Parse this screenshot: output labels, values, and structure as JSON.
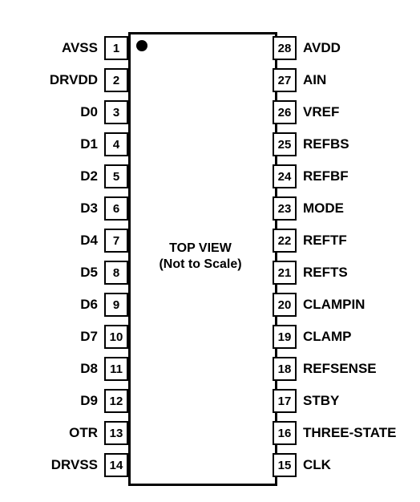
{
  "center": {
    "line1": "TOP VIEW",
    "line2": "(Not to Scale)"
  },
  "leftPins": [
    {
      "num": "1",
      "label": "AVSS"
    },
    {
      "num": "2",
      "label": "DRVDD"
    },
    {
      "num": "3",
      "label": "D0"
    },
    {
      "num": "4",
      "label": "D1"
    },
    {
      "num": "5",
      "label": "D2"
    },
    {
      "num": "6",
      "label": "D3"
    },
    {
      "num": "7",
      "label": "D4"
    },
    {
      "num": "8",
      "label": "D5"
    },
    {
      "num": "9",
      "label": "D6"
    },
    {
      "num": "10",
      "label": "D7"
    },
    {
      "num": "11",
      "label": "D8"
    },
    {
      "num": "12",
      "label": "D9"
    },
    {
      "num": "13",
      "label": "OTR"
    },
    {
      "num": "14",
      "label": "DRVSS"
    }
  ],
  "rightPins": [
    {
      "num": "28",
      "label": "AVDD"
    },
    {
      "num": "27",
      "label": "AIN"
    },
    {
      "num": "26",
      "label": "VREF"
    },
    {
      "num": "25",
      "label": "REFBS"
    },
    {
      "num": "24",
      "label": "REFBF"
    },
    {
      "num": "23",
      "label": "MODE"
    },
    {
      "num": "22",
      "label": "REFTF"
    },
    {
      "num": "21",
      "label": "REFTS"
    },
    {
      "num": "20",
      "label": "CLAMPIN"
    },
    {
      "num": "19",
      "label": "CLAMP"
    },
    {
      "num": "18",
      "label": "REFSENSE"
    },
    {
      "num": "17",
      "label": "STBY"
    },
    {
      "num": "16",
      "label": "THREE-STATE"
    },
    {
      "num": "15",
      "label": "CLK"
    }
  ]
}
